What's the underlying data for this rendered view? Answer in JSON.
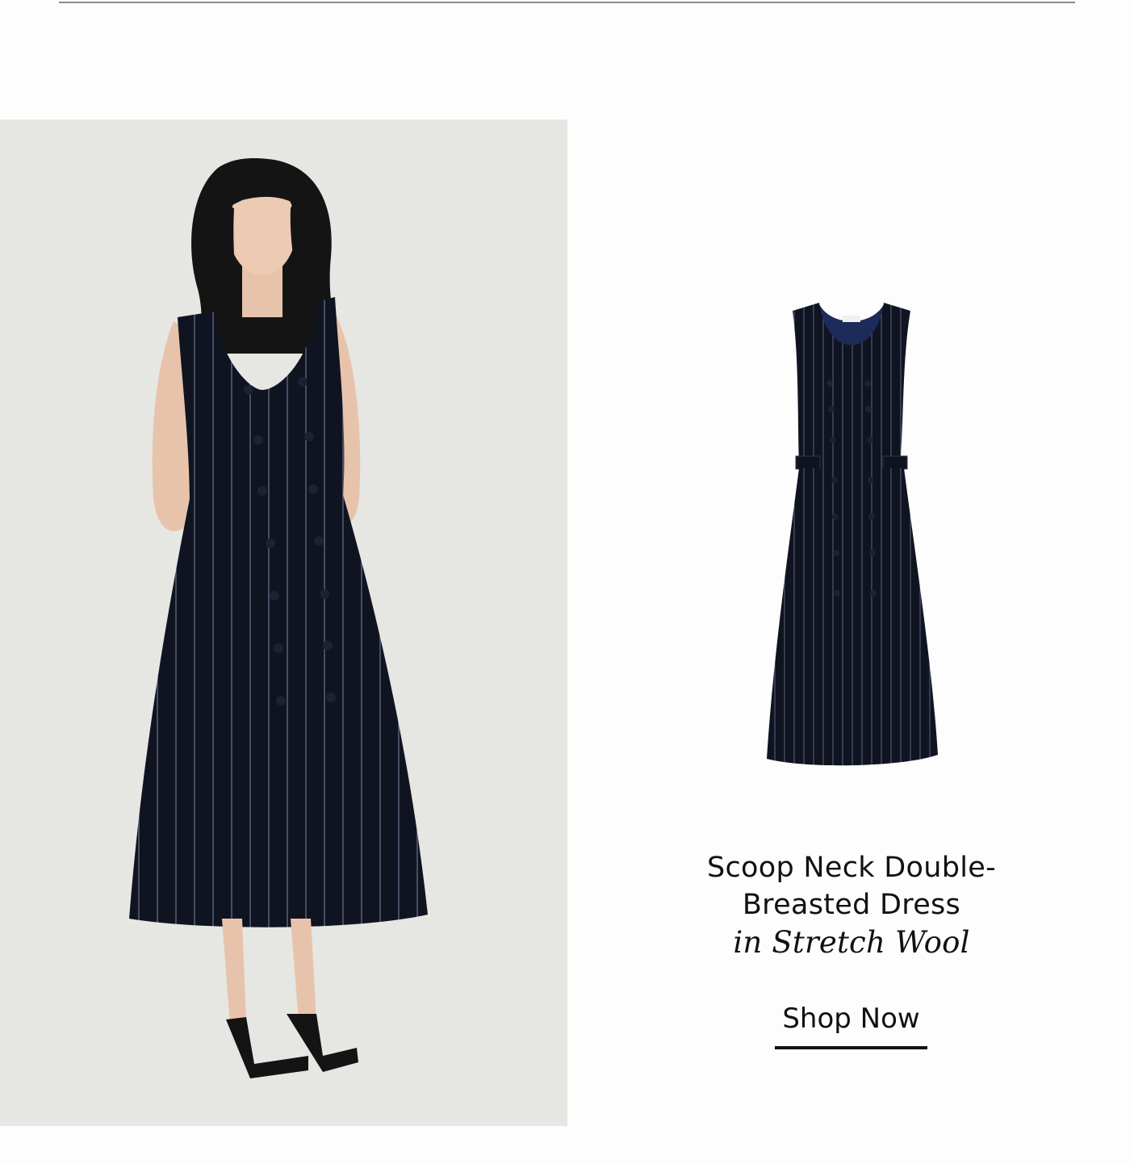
{
  "product": {
    "title": "Scoop Neck Double-Breasted Dress",
    "material": "in Stretch Wool",
    "cta_label": "Shop Now"
  },
  "colors": {
    "page_background": "#fdfdfd",
    "lifestyle_background": "#e6e6e3",
    "dress_navy": "#101522",
    "pinstripe": "#6b7190",
    "text": "#111111"
  },
  "images": {
    "lifestyle": "model-wearing-navy-pinstripe-dress",
    "product": "navy-pinstripe-dress-flat"
  }
}
